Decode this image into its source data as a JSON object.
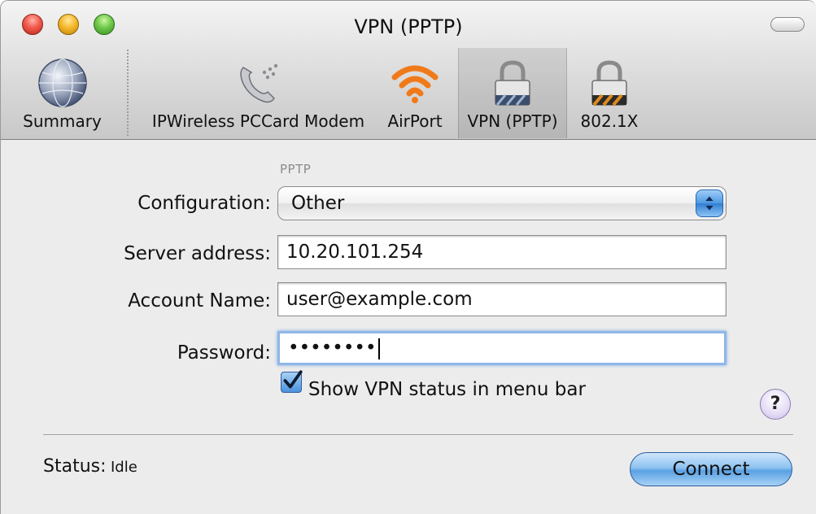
{
  "window": {
    "title": "VPN (PPTP)"
  },
  "toolbar": {
    "items": [
      {
        "label": "Summary",
        "icon": "globe-icon"
      },
      {
        "label": "IPWireless PCCard Modem",
        "icon": "phone-modem-icon"
      },
      {
        "label": "AirPort",
        "icon": "airport-wifi-icon"
      },
      {
        "label": "VPN (PPTP)",
        "icon": "lock-icon",
        "selected": true
      },
      {
        "label": "802.1X",
        "icon": "lock-striped-icon"
      }
    ]
  },
  "form": {
    "section_label": "PPTP",
    "configuration": {
      "label": "Configuration:",
      "value": "Other"
    },
    "server": {
      "label": "Server address:",
      "value": "10.20.101.254"
    },
    "account": {
      "label": "Account Name:",
      "value": "user@example.com"
    },
    "password": {
      "label": "Password:",
      "masked_value": "••••••••"
    },
    "show_status": {
      "label": "Show VPN status in menu bar",
      "checked": true
    }
  },
  "help": {
    "symbol": "?"
  },
  "status": {
    "label": "Status:",
    "value": "Idle"
  },
  "connect_button": {
    "label": "Connect"
  },
  "colors": {
    "accent_blue": "#4d98e3",
    "focus_ring": "#8fb7e8",
    "wifi_orange": "#f07a1a"
  }
}
